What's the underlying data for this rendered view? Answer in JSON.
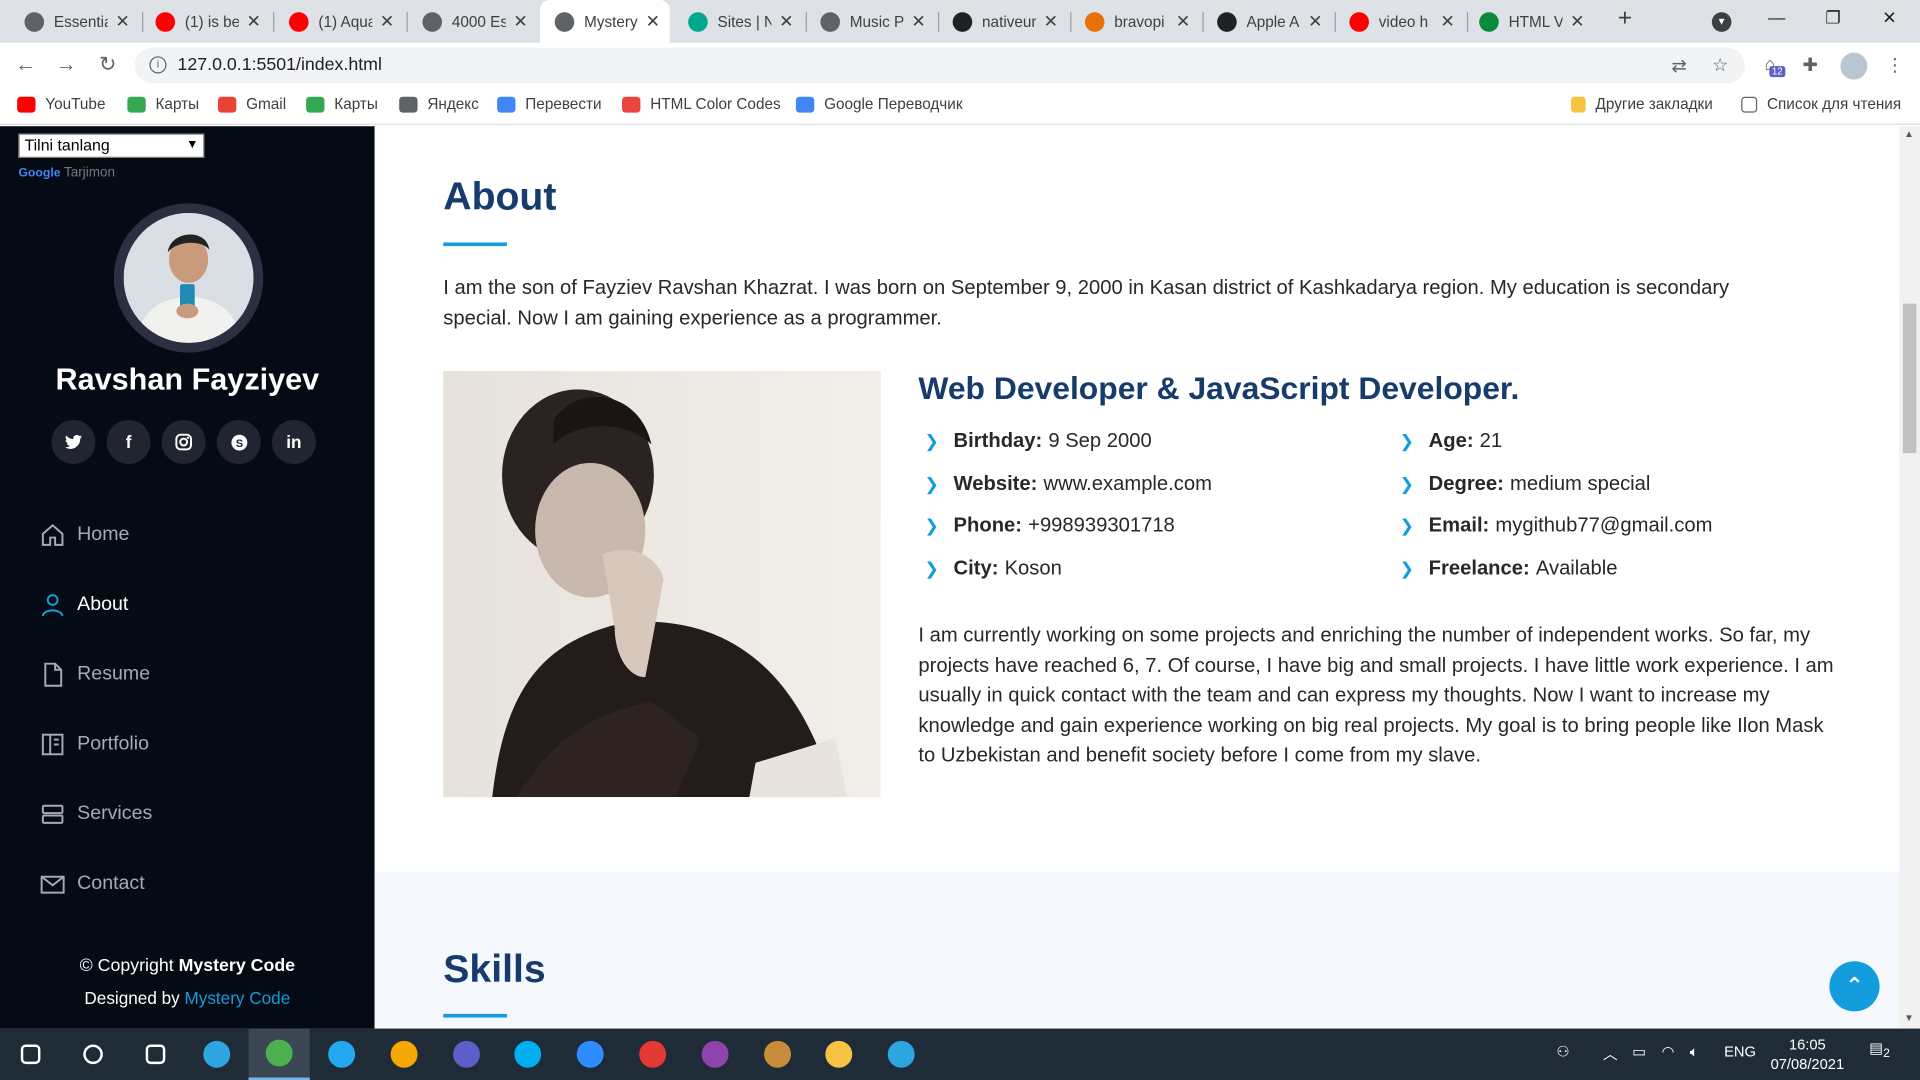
{
  "browser": {
    "tabs": [
      {
        "label": "Essentia",
        "icon": "globe-icon",
        "color": "#5f6368"
      },
      {
        "label": "(1) is be",
        "icon": "youtube-icon",
        "color": "#ff0000"
      },
      {
        "label": "(1) Aqua",
        "icon": "youtube-icon",
        "color": "#ff0000"
      },
      {
        "label": "4000 Es",
        "icon": "globe-icon",
        "color": "#5f6368"
      },
      {
        "label": "Mystery",
        "icon": "globe-icon",
        "color": "#5f6368"
      },
      {
        "label": "Sites | N",
        "icon": "diamond-icon",
        "color": "#00a88e"
      },
      {
        "label": "Music P",
        "icon": "globe-icon",
        "color": "#5f6368"
      },
      {
        "label": "nativeur",
        "icon": "r-icon",
        "color": "#202124"
      },
      {
        "label": "bravopi",
        "icon": "bravo-icon",
        "color": "#e8710a"
      },
      {
        "label": "Apple A",
        "icon": "airpods-icon",
        "color": "#202124"
      },
      {
        "label": "video h",
        "icon": "yandex-icon",
        "color": "#ff0000"
      },
      {
        "label": "HTML V",
        "icon": "w3-icon",
        "color": "#0a8a3a"
      }
    ],
    "active_tab": 4,
    "url": "127.0.0.1:5501/index.html",
    "extension_badge": "12",
    "bookmarks": [
      {
        "label": "YouTube",
        "icon": "youtube-icon",
        "color": "#ff0000"
      },
      {
        "label": "Карты",
        "icon": "maps-icon",
        "color": "#34a853"
      },
      {
        "label": "Gmail",
        "icon": "gmail-icon",
        "color": "#ea4335"
      },
      {
        "label": "Карты",
        "icon": "maps-icon",
        "color": "#34a853"
      },
      {
        "label": "Яндекс",
        "icon": "globe-icon",
        "color": "#5f6368"
      },
      {
        "label": "Перевести",
        "icon": "translate-icon",
        "color": "#4285f4"
      },
      {
        "label": "HTML Color Codes",
        "icon": "color-codes-icon",
        "color": "#e8453c"
      },
      {
        "label": "Google Переводчик",
        "icon": "translate-icon",
        "color": "#4285f4"
      }
    ],
    "other_bookmarks": "Другие закладки",
    "reading_list": "Список для чтения"
  },
  "sidebar": {
    "language_select": "Tilni tanlang",
    "google_label": "Google",
    "translate_label": "Tarjimon",
    "name": "Ravshan Fayziyev",
    "social": [
      {
        "icon": "twitter-icon",
        "glyph": "t"
      },
      {
        "icon": "facebook-icon",
        "glyph": "f"
      },
      {
        "icon": "instagram-icon",
        "glyph": "◎"
      },
      {
        "icon": "skype-icon",
        "glyph": "S"
      },
      {
        "icon": "linkedin-icon",
        "glyph": "in"
      }
    ],
    "nav": [
      {
        "label": "Home",
        "icon": "home-icon",
        "active": false
      },
      {
        "label": "About",
        "icon": "user-icon",
        "active": true
      },
      {
        "label": "Resume",
        "icon": "file-icon",
        "active": false
      },
      {
        "label": "Portfolio",
        "icon": "book-icon",
        "active": false
      },
      {
        "label": "Services",
        "icon": "server-icon",
        "active": false
      },
      {
        "label": "Contact",
        "icon": "envelope-icon",
        "active": false
      }
    ],
    "copyright_prefix": "© Copyright ",
    "copyright_brand": "Mystery Code",
    "designed_prefix": "Designed by ",
    "designed_link": "Mystery Code"
  },
  "about": {
    "title": "About",
    "intro": "I am the son of Fayziev Ravshan Khazrat. I was born on September 9, 2000 in Kasan district of Kashkadarya region. My education is secondary special. Now I am gaining experience as a programmer.",
    "role": "Web Developer & JavaScript Developer.",
    "facts_left": [
      {
        "label": "Birthday:",
        "value": "9 Sep 2000"
      },
      {
        "label": "Website:",
        "value": "www.example.com"
      },
      {
        "label": "Phone:",
        "value": "+998939301718"
      },
      {
        "label": "City:",
        "value": "Koson"
      }
    ],
    "facts_right": [
      {
        "label": "Age:",
        "value": "21"
      },
      {
        "label": "Degree:",
        "value": "medium special"
      },
      {
        "label": "Email:",
        "value": "mygithub77@gmail.com"
      },
      {
        "label": "Freelance:",
        "value": "Available"
      }
    ],
    "description": "I am currently working on some projects and enriching the number of independent works. So far, my projects have reached 6, 7. Of course, I have big and small projects. I have little work experience. I am usually in quick contact with the team and can express my thoughts. Now I want to increase my knowledge and gain experience working on big real projects. My goal is to bring people like Ilon Mask to Uzbekistan and benefit society before I come from my slave."
  },
  "skills": {
    "title": "Skills"
  },
  "colors": {
    "accent": "#149ddd",
    "heading": "#173b6c",
    "sidebar_bg": "#040b14"
  },
  "taskbar": {
    "apps": [
      "windows-start-icon",
      "search-icon",
      "task-view-icon",
      "telegram-icon",
      "chrome-icon",
      "vscode-icon",
      "avast-icon",
      "screen-tool-icon",
      "skype-icon",
      "zoom-icon",
      "recorder-icon",
      "winrar-icon",
      "game-icon",
      "file-explorer-icon",
      "telegram-icon"
    ],
    "active_app": 4,
    "language": "ENG",
    "time": "16:05",
    "date": "07/08/2021",
    "notifications": "2"
  }
}
